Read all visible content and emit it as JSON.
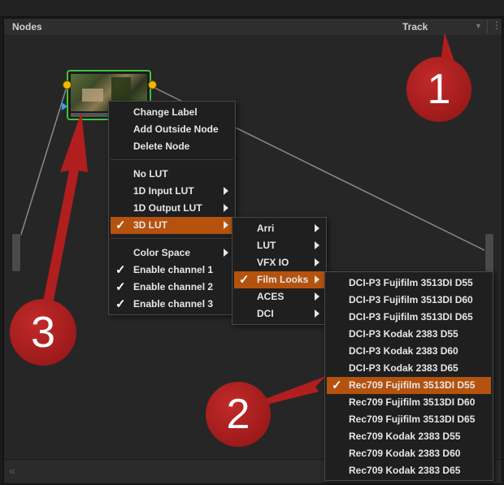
{
  "panel": {
    "title": "Nodes",
    "track_label": "Track",
    "kebab": "⋮",
    "dropdown": "▼",
    "collapse": "«"
  },
  "colors": {
    "node_border": "#3cc43c",
    "port": "#f2b700",
    "highlight": "#b4520e",
    "annotation": "#a81c1c"
  },
  "node_menu": {
    "items": [
      {
        "label": "Change Label",
        "checked": false,
        "submenu": false
      },
      {
        "label": "Add Outside Node",
        "checked": false,
        "submenu": false
      },
      {
        "label": "Delete Node",
        "checked": false,
        "submenu": false
      },
      {
        "label": "No LUT",
        "checked": false,
        "submenu": false
      },
      {
        "label": "1D Input LUT",
        "checked": false,
        "submenu": true
      },
      {
        "label": "1D Output LUT",
        "checked": false,
        "submenu": true
      },
      {
        "label": "3D LUT",
        "checked": true,
        "submenu": true,
        "selected": true
      },
      {
        "label": "Color Space",
        "checked": false,
        "submenu": true
      },
      {
        "label": "Enable channel 1",
        "checked": true,
        "submenu": false
      },
      {
        "label": "Enable channel 2",
        "checked": true,
        "submenu": false
      },
      {
        "label": "Enable channel 3",
        "checked": true,
        "submenu": false
      }
    ]
  },
  "lut_menu": {
    "items": [
      {
        "label": "Arri",
        "submenu": true
      },
      {
        "label": "LUT",
        "submenu": true
      },
      {
        "label": "VFX IO",
        "submenu": true
      },
      {
        "label": "Film Looks",
        "submenu": true,
        "checked": true,
        "selected": true
      },
      {
        "label": "ACES",
        "submenu": true
      },
      {
        "label": "DCI",
        "submenu": true
      }
    ]
  },
  "film_looks_menu": {
    "items": [
      {
        "label": "DCI-P3 Fujifilm 3513DI D55"
      },
      {
        "label": "DCI-P3 Fujifilm 3513DI D60"
      },
      {
        "label": "DCI-P3 Fujifilm 3513DI D65"
      },
      {
        "label": "DCI-P3 Kodak 2383 D55"
      },
      {
        "label": "DCI-P3 Kodak 2383 D60"
      },
      {
        "label": "DCI-P3 Kodak 2383 D65"
      },
      {
        "label": "Rec709 Fujifilm 3513DI D55",
        "checked": true,
        "selected": true
      },
      {
        "label": "Rec709 Fujifilm 3513DI D60"
      },
      {
        "label": "Rec709 Fujifilm 3513DI D65"
      },
      {
        "label": "Rec709 Kodak 2383 D55"
      },
      {
        "label": "Rec709 Kodak 2383 D60"
      },
      {
        "label": "Rec709 Kodak 2383 D65"
      }
    ]
  },
  "annotations": [
    {
      "label": "1"
    },
    {
      "label": "2"
    },
    {
      "label": "3"
    }
  ],
  "check_glyph": "✓"
}
